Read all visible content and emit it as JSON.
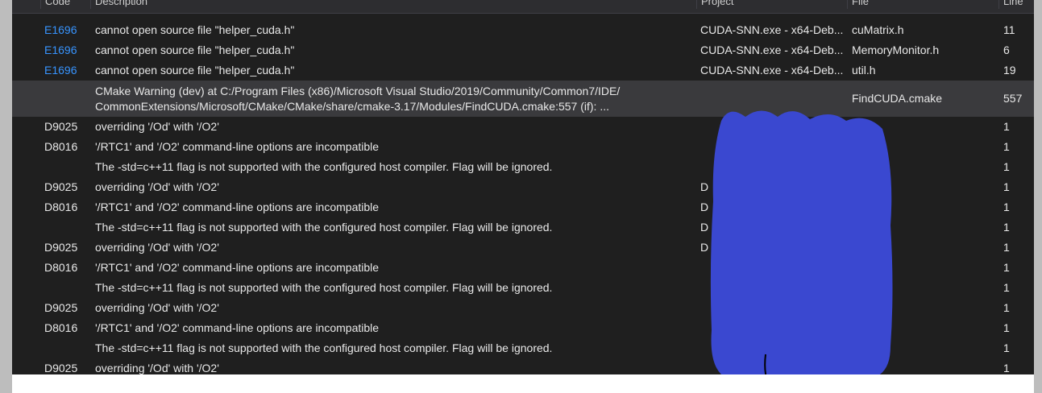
{
  "header": {
    "columns": [
      "Code",
      "Description",
      "Project",
      "File",
      "Line"
    ]
  },
  "rows": [
    {
      "icon": "build-error-icon",
      "code": "E1696",
      "code_link": true,
      "description": "cannot open source file \"helper_cuda.h\"",
      "project": "CUDA-SNN.exe - x64-Deb...",
      "file": "cuMatrix.h",
      "line": "11"
    },
    {
      "icon": "build-error-icon",
      "code": "E1696",
      "code_link": true,
      "description": "cannot open source file \"helper_cuda.h\"",
      "project": "CUDA-SNN.exe - x64-Deb...",
      "file": "MemoryMonitor.h",
      "line": "6"
    },
    {
      "icon": "build-error-icon",
      "code": "E1696",
      "code_link": true,
      "description": "cannot open source file \"helper_cuda.h\"",
      "project": "CUDA-SNN.exe - x64-Deb...",
      "file": "util.h",
      "line": "19"
    },
    {
      "icon": "warning-icon",
      "code": "",
      "description_line1": "CMake Warning (dev) at C:/Program Files (x86)/Microsoft Visual Studio/2019/Community/Common7/IDE/",
      "description_line2": "CommonExtensions/Microsoft/CMake/CMake/share/cmake-3.17/Modules/FindCUDA.cmake:557 (if): ...",
      "project": "",
      "file": "FindCUDA.cmake",
      "line": "557",
      "selected": true
    },
    {
      "icon": "warning-icon",
      "code": "D9025",
      "description": "overriding '/Od' with '/O2'",
      "project": "",
      "file": "",
      "line": "1"
    },
    {
      "icon": "error-icon",
      "code": "D8016",
      "description": "'/RTC1' and '/O2' command-line options are incompatible",
      "project": "",
      "file": "",
      "line": "1"
    },
    {
      "icon": "warning-icon",
      "code": "",
      "description": "The -std=c++11 flag is not supported with the configured host compiler. Flag will be ignored.",
      "project": "",
      "file": "",
      "line": "1"
    },
    {
      "icon": "warning-icon",
      "code": "D9025",
      "description": "overriding '/Od' with '/O2'",
      "project": "D",
      "file": "",
      "line": "1"
    },
    {
      "icon": "error-icon",
      "code": "D8016",
      "description": "'/RTC1' and '/O2' command-line options are incompatible",
      "project": "D",
      "file": "",
      "line": "1"
    },
    {
      "icon": "warning-icon",
      "code": "",
      "description": "The -std=c++11 flag is not supported with the configured host compiler. Flag will be ignored.",
      "project": "D",
      "file": "",
      "line": "1"
    },
    {
      "icon": "warning-icon",
      "code": "D9025",
      "description": "overriding '/Od' with '/O2'",
      "project": "D",
      "file": "",
      "line": "1"
    },
    {
      "icon": "error-icon",
      "code": "D8016",
      "description": "'/RTC1' and '/O2' command-line options are incompatible",
      "project": "",
      "file": "",
      "line": "1"
    },
    {
      "icon": "warning-icon",
      "code": "",
      "description": "The -std=c++11 flag is not supported with the configured host compiler. Flag will be ignored.",
      "project": "",
      "file": "",
      "line": "1"
    },
    {
      "icon": "warning-icon",
      "code": "D9025",
      "description": "overriding '/Od' with '/O2'",
      "project": "",
      "file": "",
      "line": "1"
    },
    {
      "icon": "error-icon",
      "code": "D8016",
      "description": "'/RTC1' and '/O2' command-line options are incompatible",
      "project": "",
      "file": "",
      "line": "1"
    },
    {
      "icon": "warning-icon",
      "code": "",
      "description": "The -std=c++11 flag is not supported with the configured host compiler. Flag will be ignored.",
      "project": "",
      "file": "",
      "line": "1"
    },
    {
      "icon": "warning-icon",
      "code": "D9025",
      "description": "overriding '/Od' with '/O2'",
      "project": "",
      "file": "",
      "line": "1"
    }
  ],
  "colors": {
    "panel": "#1f1f1f",
    "selected_row": "#3a3a3d",
    "text": "#e8e8e8",
    "link": "#3794ff",
    "warning": "#f2c314",
    "error": "#e51400",
    "redaction": "#3a48d0"
  }
}
